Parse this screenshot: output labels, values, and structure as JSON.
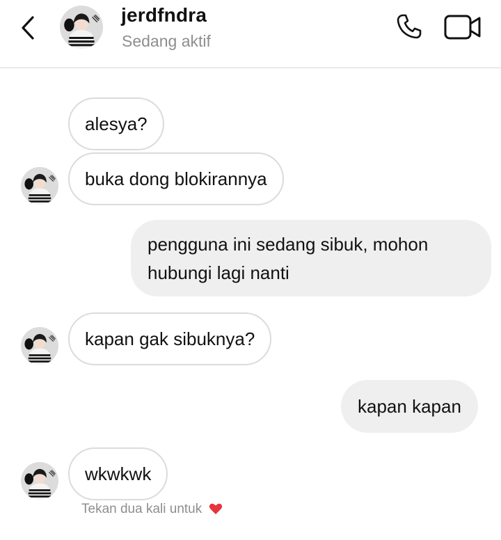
{
  "header": {
    "username": "jerdfndra",
    "status": "Sedang aktif",
    "icons": {
      "back": "chevron-left-icon",
      "call": "phone-icon",
      "video": "video-camera-icon"
    }
  },
  "messages": [
    {
      "direction": "incoming",
      "text": "alesya?"
    },
    {
      "direction": "incoming",
      "text": "buka dong blokirannya"
    },
    {
      "direction": "outgoing",
      "lines": [
        "pengguna ini sedang sibuk, mohon",
        "hubungi lagi nanti"
      ]
    },
    {
      "direction": "incoming",
      "text": "kapan gak sibuknya?"
    },
    {
      "direction": "outgoing",
      "text": "kapan kapan"
    },
    {
      "direction": "incoming",
      "text": "wkwkwk"
    }
  ],
  "footer": {
    "hint": "Tekan dua kali untuk",
    "hint_icon": "heart-icon"
  },
  "colors": {
    "incoming_border": "#dbdbdb",
    "outgoing_bg": "#efefef",
    "muted_text": "#8e8e8e",
    "heart": "#e8343b"
  }
}
